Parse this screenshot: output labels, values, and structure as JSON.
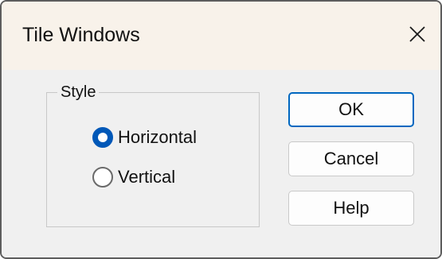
{
  "window": {
    "title": "Tile Windows",
    "close_icon": "close-icon"
  },
  "style_group": {
    "label": "Style",
    "options": [
      {
        "label": "Horizontal",
        "checked": true
      },
      {
        "label": "Vertical",
        "checked": false
      }
    ]
  },
  "buttons": {
    "ok": "OK",
    "cancel": "Cancel",
    "help": "Help"
  },
  "colors": {
    "accent": "#0058b8",
    "titlebar": "#f8f2ea",
    "body": "#f0f0f0"
  }
}
